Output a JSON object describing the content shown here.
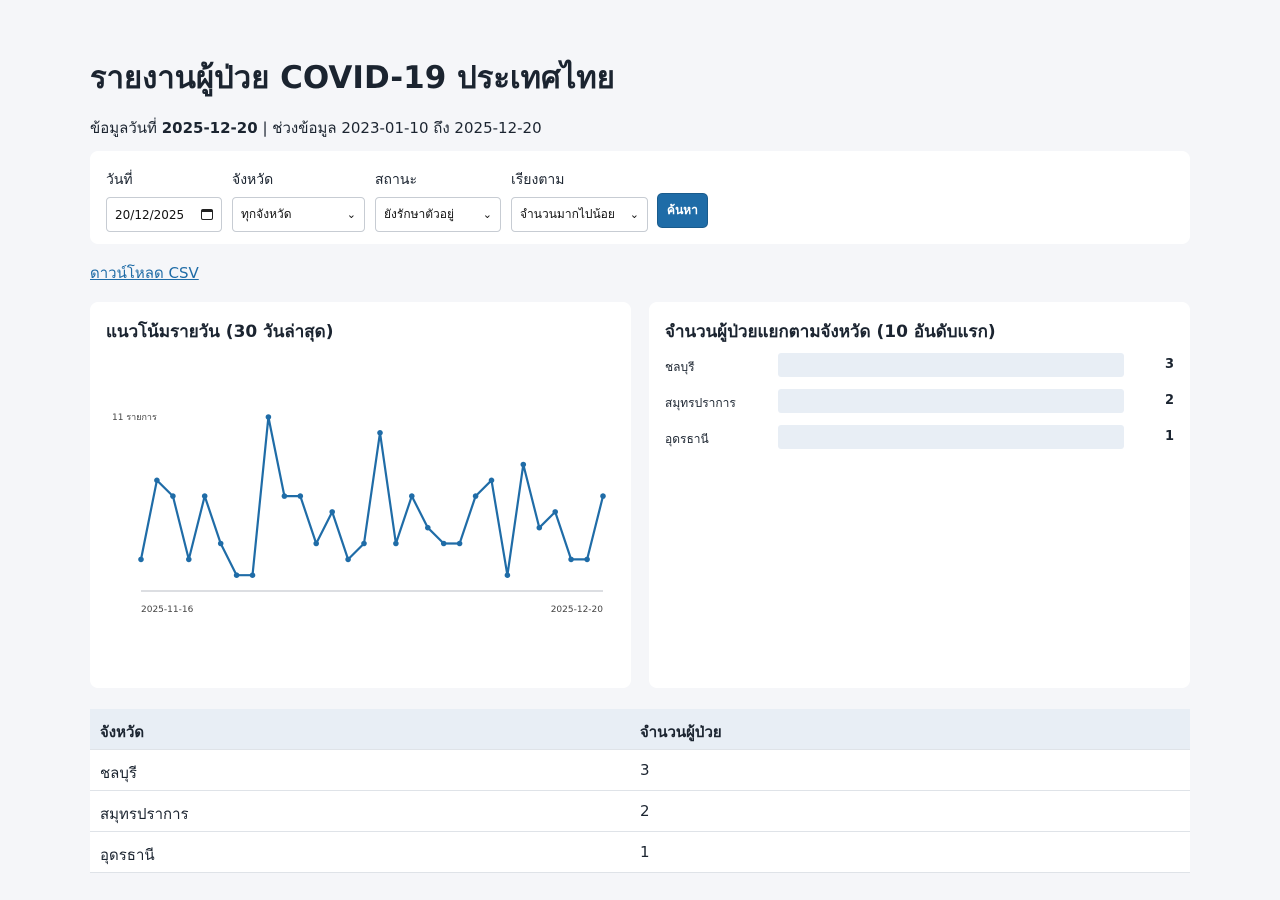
{
  "header": {
    "title": "รายงานผู้ป่วย COVID-19 ประเทศไทย",
    "subtitle_prefix": "ข้อมูลวันที่",
    "data_date": "2025-12-20",
    "subtitle_sep": "|",
    "range_text": "ช่วงข้อมูล 2023-01-10 ถึง 2025-12-20"
  },
  "filters": {
    "date_label": "วันที่",
    "date_value": "20/12/2025",
    "province_label": "จังหวัด",
    "province_value": "ทุกจังหวัด",
    "status_label": "สถานะ",
    "status_value": "ยังรักษาตัวอยู่",
    "sort_label": "เรียงตาม",
    "sort_value": "จำนวนมากไปน้อย",
    "search_label": "ค้นหา"
  },
  "download": {
    "label": "ดาวน์โหลด CSV"
  },
  "trend": {
    "title": "แนวโน้มรายวัน (30 วันล่าสุด)",
    "max_label": "11 รายการ",
    "start_label": "2025-11-16",
    "end_label": "2025-12-20"
  },
  "by_province": {
    "title": "จำนวนผู้ป่วยแยกตามจังหวัด (10 อันดับแรก)",
    "rows": [
      {
        "province": "ชลบุรี",
        "count": "3"
      },
      {
        "province": "สมุทรปราการ",
        "count": "2"
      },
      {
        "province": "อุดรธานี",
        "count": "1"
      }
    ]
  },
  "table": {
    "col_province": "จังหวัด",
    "col_count": "จำนวนผู้ป่วย",
    "rows": [
      {
        "province": "ชลบุรี",
        "count": "3"
      },
      {
        "province": "สมุทรปราการ",
        "count": "2"
      },
      {
        "province": "อุดรธานี",
        "count": "1"
      }
    ]
  },
  "colors": {
    "accent": "#1f6ca7",
    "bar_track": "#e8eef5",
    "table_head": "#e8eef5"
  },
  "chart_data": {
    "type": "line",
    "title": "แนวโน้มรายวัน (30 วันล่าสุด)",
    "xlabel": "",
    "ylabel": "",
    "x_start": "2025-11-16",
    "x_end": "2025-12-20",
    "ylim": [
      0,
      11
    ],
    "values": [
      2,
      7,
      6,
      2,
      6,
      3,
      1,
      1,
      11,
      6,
      6,
      3,
      5,
      2,
      3,
      10,
      3,
      6,
      4,
      3,
      3,
      6,
      7,
      1,
      8,
      4,
      5,
      2,
      2,
      6
    ]
  }
}
